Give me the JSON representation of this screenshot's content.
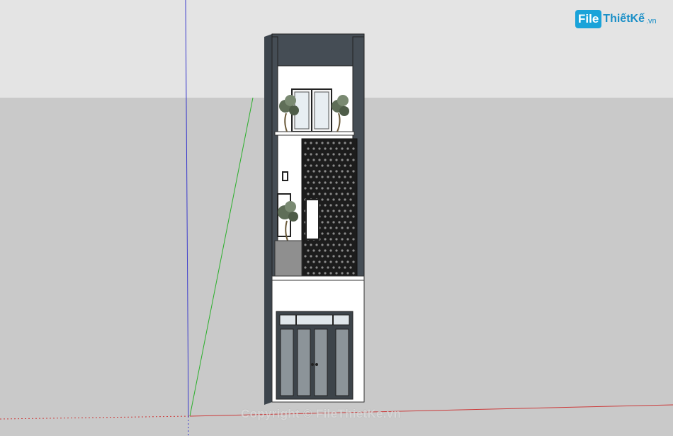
{
  "logo": {
    "badge": "File",
    "name": "ThiếtKế",
    "suffix": ".vn"
  },
  "watermark": {
    "text": "Copyright © FileThietKe.vn"
  },
  "colors": {
    "sky": "#e4e4e4",
    "ground": "#c9c9c9",
    "facade_dark": "#454d55",
    "facade_white": "#ffffff",
    "axis_blue": "#3a3acc",
    "axis_green": "#2bb02b",
    "axis_red": "#cc3a3a",
    "brand": "#1aa3d9"
  }
}
